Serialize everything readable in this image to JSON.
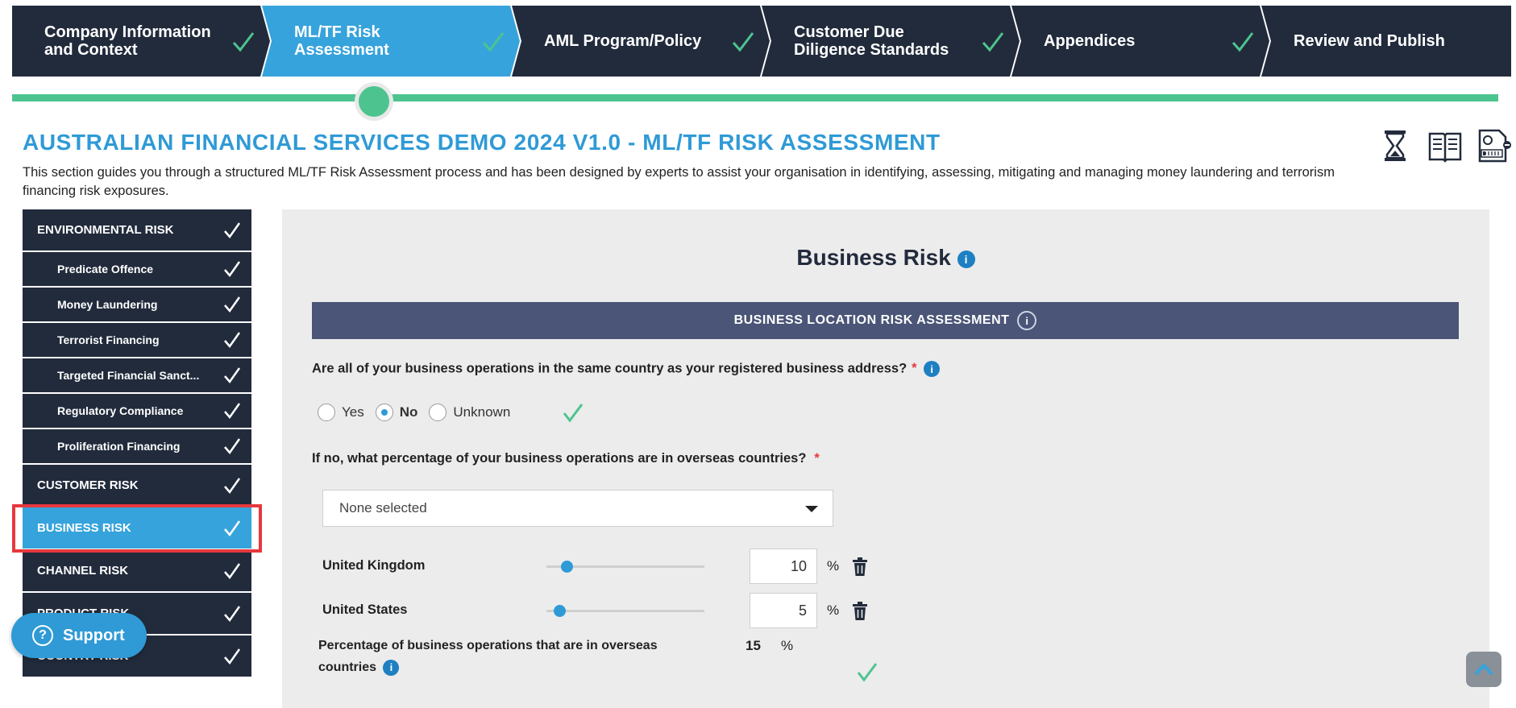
{
  "wizard": {
    "steps": [
      {
        "label": "Company Information and Context",
        "completed": true
      },
      {
        "label": "ML/TF Risk Assessment",
        "completed": true,
        "active": true
      },
      {
        "label": "AML Program/Policy",
        "completed": true
      },
      {
        "label": "Customer Due Diligence Standards",
        "completed": true
      },
      {
        "label": "Appendices",
        "completed": true
      },
      {
        "label": "Review and Publish",
        "completed": false
      }
    ]
  },
  "header": {
    "title": "AUSTRALIAN FINANCIAL SERVICES DEMO 2024 V1.0 - ML/TF RISK ASSESSMENT",
    "description": "This section guides you through a structured ML/TF Risk Assessment process and has been designed by experts to assist your organisation in identifying, assessing, mitigating and managing money laundering and terrorism financing risk exposures.",
    "tool_icons": [
      "hourglass-icon",
      "open-book-icon",
      "draft-document-icon"
    ]
  },
  "sidebar": {
    "items": [
      {
        "label": "ENVIRONMENTAL RISK",
        "level": "main"
      },
      {
        "label": "Predicate Offence",
        "level": "sub"
      },
      {
        "label": "Money Laundering",
        "level": "sub"
      },
      {
        "label": "Terrorist Financing",
        "level": "sub"
      },
      {
        "label": "Targeted Financial Sanct...",
        "level": "sub"
      },
      {
        "label": "Regulatory Compliance",
        "level": "sub"
      },
      {
        "label": "Proliferation Financing",
        "level": "sub"
      },
      {
        "label": "CUSTOMER RISK",
        "level": "main"
      },
      {
        "label": "BUSINESS RISK",
        "level": "main",
        "active": true
      },
      {
        "label": "CHANNEL RISK",
        "level": "main"
      },
      {
        "label": "PRODUCT RISK",
        "level": "main"
      },
      {
        "label": "COUNTRY RISK",
        "level": "main"
      }
    ],
    "support_label": "Support"
  },
  "main": {
    "section_title": "Business Risk",
    "info_glyph": "i",
    "bar_title": "BUSINESS LOCATION RISK ASSESSMENT",
    "question1": "Are all of your business operations in the same country as your registered business address?",
    "required_mark": "*",
    "radio_options": [
      "Yes",
      "No",
      "Unknown"
    ],
    "radio_selected": "No",
    "question2": "If no, what percentage of your business operations are in overseas countries?",
    "dropdown_value": "None selected",
    "countries": [
      {
        "name": "United Kingdom",
        "value": "10",
        "slider_fraction": 0.13
      },
      {
        "name": "United States",
        "value": "5",
        "slider_fraction": 0.08
      }
    ],
    "percent_sign": "%",
    "total_label": "Percentage of business operations that are in overseas countries",
    "total_value": "15"
  },
  "colors": {
    "nav_dark": "#222b3c",
    "accent_blue": "#36a3dc",
    "success_green": "#4dc48f",
    "bar_slate": "#4a5577",
    "highlight_red": "#e7383d"
  }
}
